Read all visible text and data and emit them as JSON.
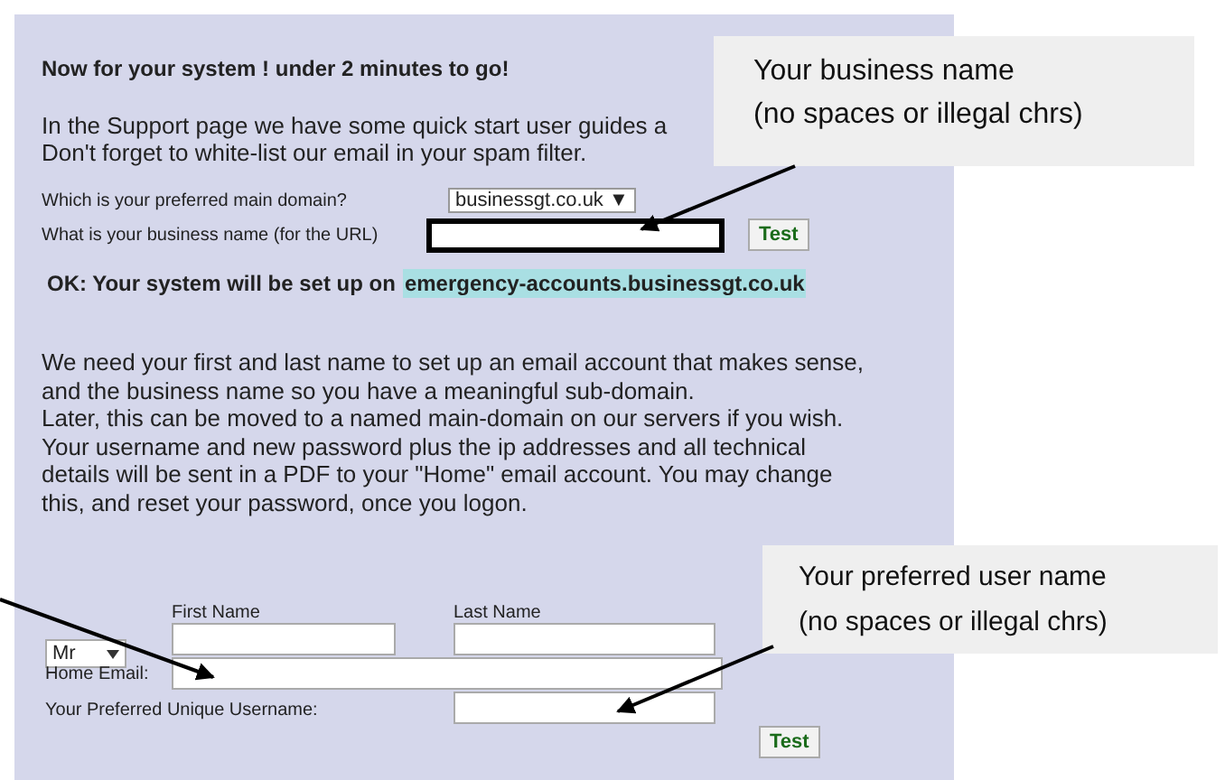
{
  "heading": "Now for your system ! under 2 minutes to go!",
  "intro": [
    "In the Support page we have some quick start user guides a",
    "Don't forget to white-list our email in your spam filter."
  ],
  "domain": {
    "label": "Which is your preferred main domain?",
    "value": "businessgt.co.uk ▼"
  },
  "business": {
    "label": "What is your business name (for the URL)",
    "button": "Test"
  },
  "ok": {
    "text": "OK: Your system will be set up on",
    "link": "emergency-accounts.businessgt.co.uk"
  },
  "explanation": [
    "We need your first and last name to set up an email account that makes sense,",
    "and the business name so you have a meaningful sub-domain.",
    "Later, this can be moved to a named main-domain on our servers if you wish.",
    "Your username and new password plus the ip addresses and all technical",
    "details will be sent in a PDF to your \"Home\" email account. You may change",
    "this, and reset your password, once you logon."
  ],
  "name": {
    "title": "Mr",
    "first_label": "First Name",
    "last_label": "Last Name"
  },
  "email": {
    "label": "Home Email:"
  },
  "username": {
    "label": "Your Preferred Unique  Username:",
    "button": "Test"
  },
  "callouts": [
    {
      "lines": [
        "Your business name",
        "(no spaces or illegal chrs)"
      ]
    },
    {
      "lines": [
        "Your preferred user name",
        "(no spaces or illegal chrs)"
      ]
    }
  ]
}
